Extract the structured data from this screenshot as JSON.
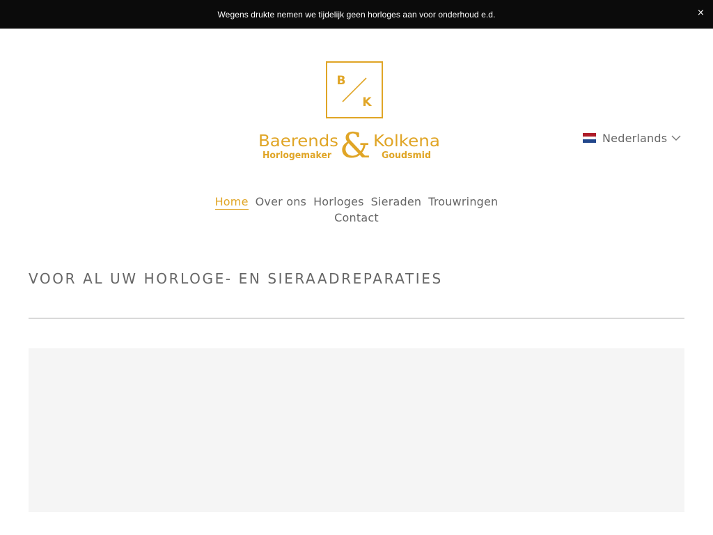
{
  "announcement": {
    "text": "Wegens drukte nemen we tijdelijk geen horloges aan voor onderhoud e.d.",
    "close_icon": "close-icon",
    "close_symbol": "×"
  },
  "logo": {
    "monogram_b": "B",
    "monogram_k": "K",
    "name_left": "Baerends",
    "ampersand": "&",
    "name_right": "Kolkena",
    "sub_left": "Horlogemaker",
    "sub_right": "Goudsmid",
    "color": "#e0a526"
  },
  "language": {
    "label": "Nederlands",
    "flag_colors": [
      "#ae1c28",
      "#ffffff",
      "#21468b"
    ],
    "chevron_icon": "chevron-down-icon"
  },
  "nav": {
    "items": [
      {
        "label": "Home",
        "active": true
      },
      {
        "label": "Over ons",
        "active": false
      },
      {
        "label": "Horloges",
        "active": false
      },
      {
        "label": "Sieraden",
        "active": false
      },
      {
        "label": "Trouwringen",
        "active": false
      },
      {
        "label": "Contact",
        "active": false
      }
    ],
    "accent": "#e0a526"
  },
  "hero": {
    "title": "VOOR AL UW HORLOGE- EN SIERAADREPARATIES"
  }
}
